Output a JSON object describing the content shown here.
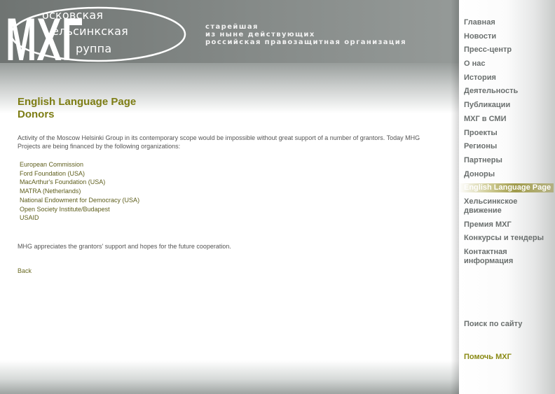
{
  "header": {
    "logo": {
      "letters": "МХГ",
      "word1": "осковская",
      "word2": "ельсинкская",
      "word3": "руппа"
    },
    "tagline": [
      "старейшая",
      "из ныне действующих",
      "российская правозащитная организация"
    ]
  },
  "main": {
    "title_line1": "English Language Page",
    "title_line2": "Donors",
    "intro": "Activity of the Moscow Helsinki Group in its contemporary scope would be impossible without great support of a number of grantors. Today MHG Projects are being financed by the following organizations:",
    "donors": [
      "European Commission",
      "Ford Foundation (USA)",
      "MacArthur's Foundation (USA)",
      "MATRA (Netherlands)",
      "National Endowment for Democracy (USA)",
      "Open Society Institute/Budapest",
      "USAID"
    ],
    "closing": "MHG appreciates the grantors' support and hopes for the future cooperation.",
    "back_label": "Back"
  },
  "sidebar": {
    "items": [
      {
        "label": "Главная"
      },
      {
        "label": "Новости"
      },
      {
        "label": "Пресс-центр"
      },
      {
        "label": "О нас"
      },
      {
        "label": "История"
      },
      {
        "label": "Деятельность"
      },
      {
        "label": "Публикации"
      },
      {
        "label": "МХГ в СМИ"
      },
      {
        "label": "Проекты"
      },
      {
        "label": "Регионы"
      },
      {
        "label": "Партнеры"
      },
      {
        "label": "Доноры"
      },
      {
        "label": "English Language Page"
      },
      {
        "label": "Хельсинкское движение"
      },
      {
        "label": "Премия МХГ"
      },
      {
        "label": "Конкурсы и тендеры"
      },
      {
        "label": "Контактная информация"
      }
    ],
    "active_index": 12,
    "search_label": "Поиск по сайту",
    "help_label": "Помочь МХГ"
  },
  "colors": {
    "title": "#7d7d14",
    "header_gray": "#858a88",
    "nav_text": "#6a6f6e",
    "accent_olive": "#9f9a4a"
  }
}
